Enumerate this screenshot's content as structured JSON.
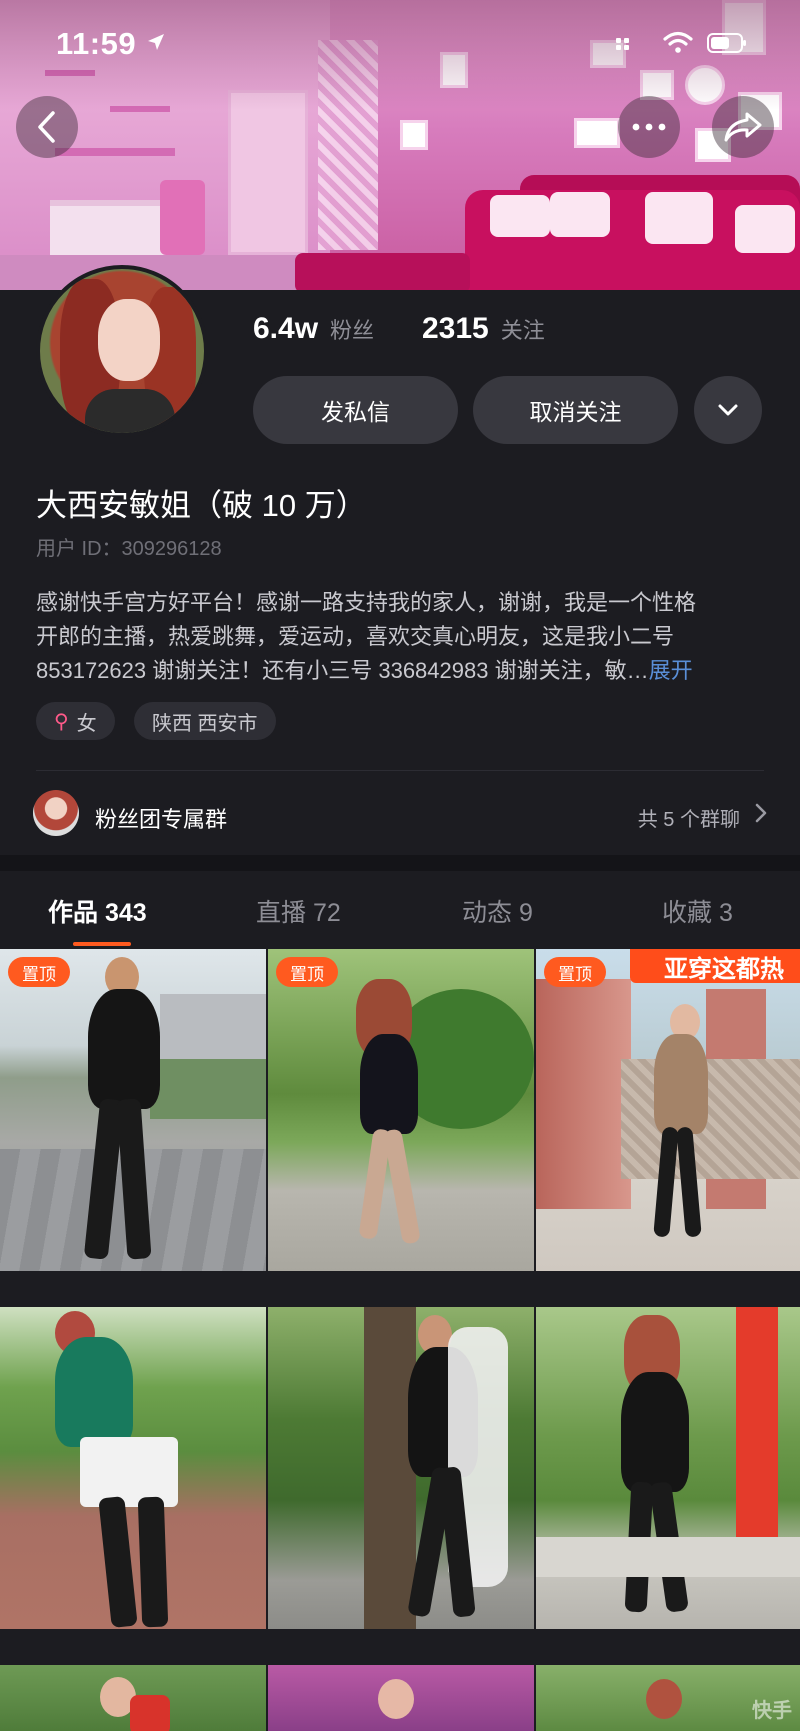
{
  "status_bar": {
    "time": "11:59"
  },
  "profile": {
    "stats": {
      "fans_value": "6.4w",
      "fans_label": "粉丝",
      "following_value": "2315",
      "following_label": "关注"
    },
    "buttons": {
      "message": "发私信",
      "unfollow": "取消关注"
    },
    "name": "大西安敏姐（破 10 万）",
    "user_id": "用户 ID：309296128",
    "bio_lines": [
      "感谢快手宫方好平台！感谢一路支持我的家人，谢谢，我是一个性格",
      "开郎的主播，热爱跳舞，爱运动，喜欢交真心明友，这是我小二号",
      "853172623 谢谢关注！还有小三号 336842983 谢谢关注，敏…"
    ],
    "bio_expand": "展开",
    "tags": {
      "gender": "女",
      "gender_symbol": "⚲",
      "location": "陕西 西安市"
    }
  },
  "group": {
    "title": "粉丝团专属群",
    "count": "共 5 个群聊"
  },
  "tabs": [
    {
      "label": "作品 343",
      "active": true
    },
    {
      "label": "直播 72",
      "active": false
    },
    {
      "label": "动态 9",
      "active": false
    },
    {
      "label": "收藏 3",
      "active": false
    }
  ],
  "grid": {
    "pinned_label": "置顶",
    "banner_text": "亚穿这都热",
    "watermark": "快手"
  },
  "colors": {
    "accent": "#ff5a1f",
    "link": "#5a8fd8",
    "background": "#1c1c21"
  }
}
